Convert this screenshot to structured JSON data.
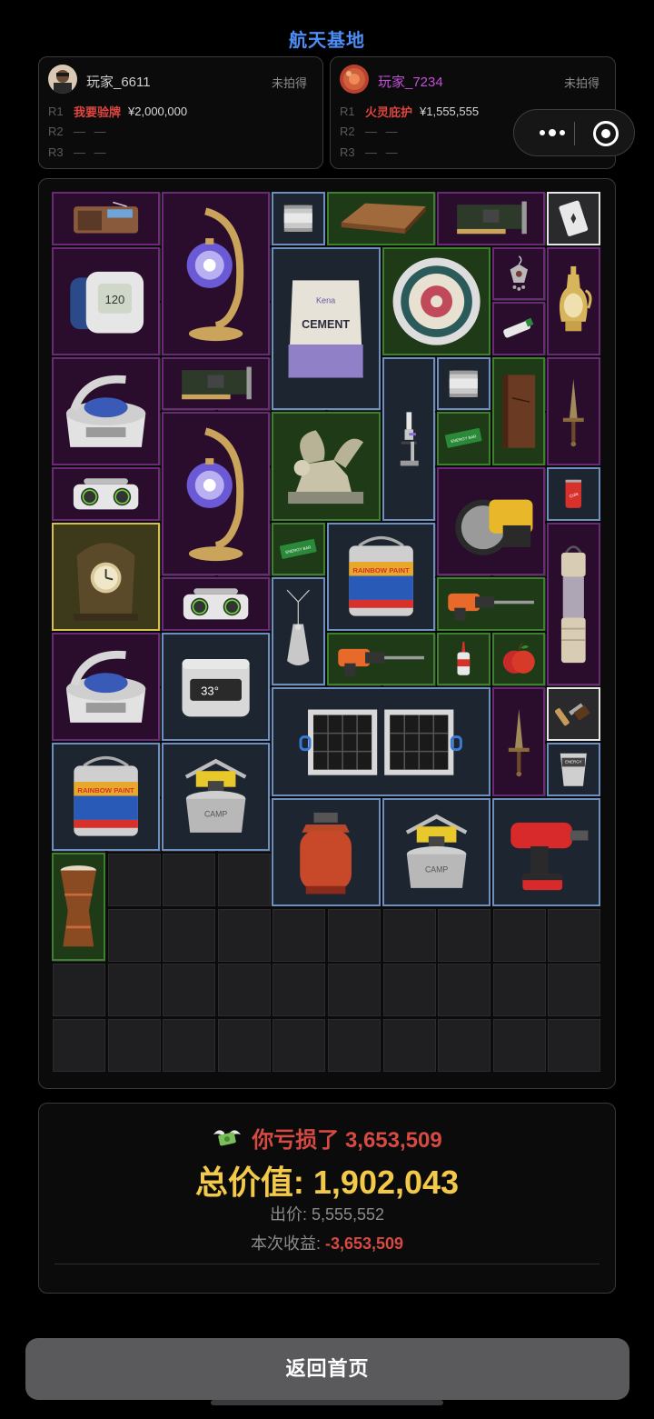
{
  "header": {
    "title": "航天基地"
  },
  "players": [
    {
      "name": "玩家_6611",
      "status": "未拍得",
      "rounds": [
        {
          "label": "R1",
          "tag": "我要验牌",
          "value": "¥2,000,000"
        },
        {
          "label": "R2",
          "dash": "— —"
        },
        {
          "label": "R3",
          "dash": "— —"
        }
      ]
    },
    {
      "name": "玩家_7234",
      "name_color": "#c250d6",
      "status": "未拍得",
      "rounds": [
        {
          "label": "R1",
          "tag": "火灵庇护",
          "value": "¥1,555,555"
        },
        {
          "label": "R2",
          "dash": "— —"
        },
        {
          "label": "R3",
          "dash": "— —"
        }
      ]
    }
  ],
  "items": [
    {
      "name": "radio",
      "rarity": "purple",
      "icon": "radio-icon"
    },
    {
      "name": "turkish-lamp",
      "rarity": "purple",
      "icon": "lamp-icon"
    },
    {
      "name": "canned-beef",
      "rarity": "blue",
      "icon": "can-icon"
    },
    {
      "name": "wood-board",
      "rarity": "green",
      "icon": "wood-board-icon"
    },
    {
      "name": "circuit-card",
      "rarity": "purple",
      "icon": "circuit-card-icon"
    },
    {
      "name": "playing-card",
      "rarity": "white",
      "icon": "card-icon"
    },
    {
      "name": "blood-pressure-monitor",
      "rarity": "purple",
      "icon": "monitor-icon"
    },
    {
      "name": "cement-bag",
      "rarity": "blue",
      "icon": "cement-icon",
      "label": "CEMENT"
    },
    {
      "name": "decorative-plate",
      "rarity": "green",
      "icon": "plate-icon"
    },
    {
      "name": "earring",
      "rarity": "purple",
      "icon": "earring-icon"
    },
    {
      "name": "golden-jug",
      "rarity": "purple",
      "icon": "jug-icon"
    },
    {
      "name": "glue-tube",
      "rarity": "purple",
      "icon": "glue-icon"
    },
    {
      "name": "centrifuge",
      "rarity": "purple",
      "icon": "centrifuge-icon"
    },
    {
      "name": "circuit-card",
      "rarity": "purple",
      "icon": "circuit-card-icon"
    },
    {
      "name": "microscope",
      "rarity": "blue",
      "icon": "microscope-icon"
    },
    {
      "name": "canned-beef",
      "rarity": "blue",
      "icon": "can-icon"
    },
    {
      "name": "leather-book",
      "rarity": "green",
      "icon": "book-icon"
    },
    {
      "name": "dagger",
      "rarity": "purple",
      "icon": "dagger-icon"
    },
    {
      "name": "winged-lion-statue",
      "rarity": "green",
      "icon": "statue-icon"
    },
    {
      "name": "energy-bar",
      "rarity": "green",
      "icon": "energy-bar-icon"
    },
    {
      "name": "speaker",
      "rarity": "purple",
      "icon": "speaker-icon"
    },
    {
      "name": "turkish-lamp",
      "rarity": "purple",
      "icon": "lamp-icon"
    },
    {
      "name": "circular-saw",
      "rarity": "purple",
      "icon": "saw-icon"
    },
    {
      "name": "cola-can",
      "rarity": "blue",
      "icon": "cola-icon"
    },
    {
      "name": "antique-clock",
      "rarity": "gold",
      "icon": "clock-icon"
    },
    {
      "name": "energy-bar",
      "rarity": "green",
      "icon": "energy-bar-icon"
    },
    {
      "name": "paint-bucket",
      "rarity": "blue",
      "icon": "paint-icon",
      "label": "RAINBOW PAINT"
    },
    {
      "name": "camping-lantern",
      "rarity": "purple",
      "icon": "lantern-icon"
    },
    {
      "name": "pendant-necklace",
      "rarity": "blue",
      "icon": "pendant-icon"
    },
    {
      "name": "rotary-hammer",
      "rarity": "green",
      "icon": "drill-icon"
    },
    {
      "name": "speaker",
      "rarity": "purple",
      "icon": "speaker-icon"
    },
    {
      "name": "centrifuge",
      "rarity": "purple",
      "icon": "centrifuge-icon"
    },
    {
      "name": "power-station",
      "rarity": "blue",
      "icon": "power-station-icon",
      "label": "33°"
    },
    {
      "name": "rotary-hammer",
      "rarity": "green",
      "icon": "drill-icon"
    },
    {
      "name": "glue-bottle",
      "rarity": "green",
      "icon": "glue-bottle-icon"
    },
    {
      "name": "apple",
      "rarity": "green",
      "icon": "apple-icon"
    },
    {
      "name": "solar-panel",
      "rarity": "blue",
      "icon": "solar-icon"
    },
    {
      "name": "dagger",
      "rarity": "purple",
      "icon": "dagger-icon"
    },
    {
      "name": "paintbrush",
      "rarity": "white",
      "icon": "brush-icon"
    },
    {
      "name": "paint-bucket",
      "rarity": "blue",
      "icon": "paint-icon",
      "label": "RAINBOW PAINT"
    },
    {
      "name": "camping-stove",
      "rarity": "blue",
      "icon": "stove-icon"
    },
    {
      "name": "energy-cup",
      "rarity": "blue",
      "icon": "cup-icon"
    },
    {
      "name": "gas-cylinder",
      "rarity": "blue",
      "icon": "cylinder-icon"
    },
    {
      "name": "camping-stove",
      "rarity": "blue",
      "icon": "stove-icon"
    },
    {
      "name": "cordless-drill",
      "rarity": "blue",
      "icon": "cordless-drill-icon"
    },
    {
      "name": "djembe-drum",
      "rarity": "green",
      "icon": "drum-icon"
    }
  ],
  "result": {
    "loss_text": "你亏损了 3,653,509",
    "total_text": "总价值: 1,902,043",
    "bid_label": "出价: ",
    "bid_value": "5,555,552",
    "profit_label": "本次收益: ",
    "profit_value": "-3,653,509"
  },
  "footer": {
    "home_button": "返回首页"
  },
  "colors": {
    "title": "#4d8ef5",
    "loss": "#d64a42",
    "total": "#f3c94a",
    "rarity_purple": "#6a2a75",
    "rarity_blue": "#6d8fc0",
    "rarity_green": "#3f7f30",
    "rarity_gold": "#d6c04d"
  }
}
